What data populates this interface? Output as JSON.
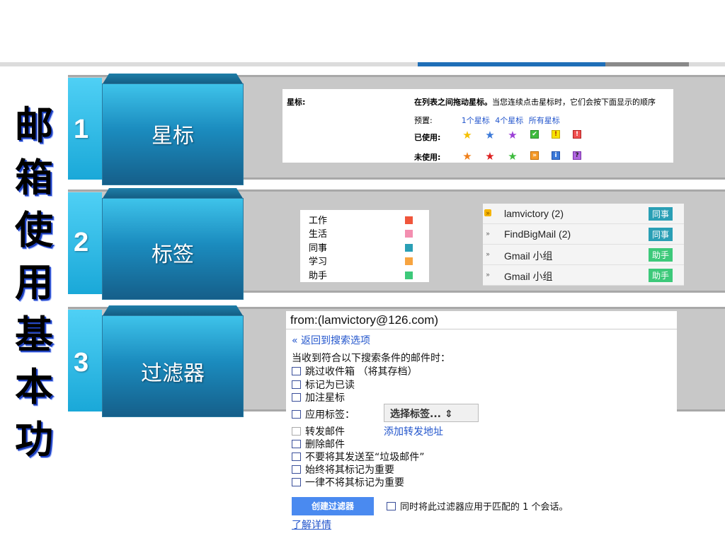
{
  "title_chars": [
    "邮",
    "箱",
    "使",
    "用",
    "基",
    "本",
    "功"
  ],
  "sections": [
    {
      "num": "1",
      "label": "星标"
    },
    {
      "num": "2",
      "label": "标签"
    },
    {
      "num": "3",
      "label": "过滤器"
    }
  ],
  "stars": {
    "header": "星标:",
    "desc_bold": "在列表之间拖动星标。",
    "desc_rest": "当您连续点击星标时，它们会按下面显示的顺序",
    "presets_label": "预置:",
    "preset_links": [
      "1个星标",
      "4个星标",
      "所有星标"
    ],
    "in_use_label": "已使用:",
    "not_in_use_label": "未使用:",
    "in_use_icons": [
      "yellow-star",
      "blue-star",
      "purple-star",
      "green-check",
      "yellow-bang",
      "red-bang"
    ],
    "not_in_use_icons": [
      "orange-star",
      "red-star",
      "green-star",
      "orange-guillemet",
      "blue-info",
      "purple-question"
    ]
  },
  "labels": {
    "items": [
      {
        "name": "工作",
        "color": "#f0553b"
      },
      {
        "name": "生活",
        "color": "#f38fb0"
      },
      {
        "name": "同事",
        "color": "#2a9fb5"
      },
      {
        "name": "学习",
        "color": "#f7a440"
      },
      {
        "name": "助手",
        "color": "#3dc97a"
      }
    ]
  },
  "mail": {
    "rows": [
      {
        "sender": "lamvictory (2)",
        "tag": "同事",
        "tag_color": "#2a9fb5",
        "important": true
      },
      {
        "sender": "FindBigMail (2)",
        "tag": "同事",
        "tag_color": "#2a9fb5",
        "important": false
      },
      {
        "sender": "Gmail 小组",
        "tag": "助手",
        "tag_color": "#3dc97a",
        "important": false
      },
      {
        "sender": "Gmail 小组",
        "tag": "助手",
        "tag_color": "#3dc97a",
        "important": false
      }
    ]
  },
  "filter": {
    "query": "from:(lamvictory@126.com)",
    "back_link": "« 返回到搜索选项",
    "intro": "当收到符合以下搜索条件的邮件时：",
    "options": [
      {
        "text": "跳过收件箱 （将其存档）"
      },
      {
        "text": "标记为已读"
      },
      {
        "text": "加注星标"
      }
    ],
    "apply_label": "应用标签：",
    "apply_select": "选择标签... ⇕",
    "forward_label": "转发邮件",
    "forward_link": "添加转发地址",
    "options2": [
      {
        "text": "删除邮件"
      },
      {
        "text": "不要将其发送至“垃圾邮件”"
      },
      {
        "text": "始终将其标记为重要"
      },
      {
        "text": "一律不将其标记为重要"
      }
    ],
    "create_button": "创建过滤器",
    "apply_also": "同时将此过滤器应用于匹配的 1 个会话。",
    "learn_more": "了解详情"
  }
}
